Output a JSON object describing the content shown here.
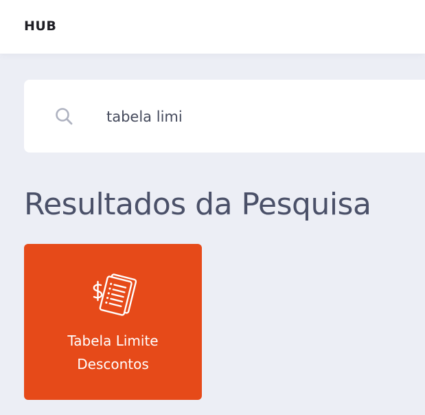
{
  "header": {
    "brand": "HUB"
  },
  "search": {
    "icon": "search-icon",
    "value": "tabela limi"
  },
  "results": {
    "title": "Resultados da Pesquisa",
    "items": [
      {
        "label": "Tabela Limite Descontos",
        "icon": "price-list-icon",
        "color": "#e64a19"
      }
    ]
  },
  "colors": {
    "background": "#eceef5",
    "accent": "#e64a19",
    "title_text": "#4a5068"
  }
}
